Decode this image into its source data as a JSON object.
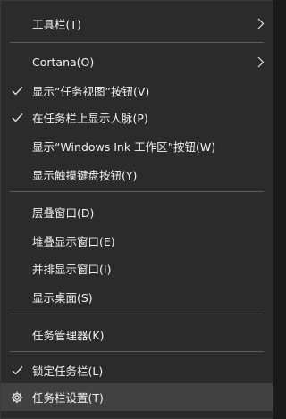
{
  "menu": {
    "items": [
      {
        "label": "工具栏(T)"
      },
      {
        "label": "Cortana(O)"
      },
      {
        "label": "显示“任务视图”按钮(V)"
      },
      {
        "label": "在任务栏上显示人脉(P)"
      },
      {
        "label": "显示“Windows Ink 工作区”按钮(W)"
      },
      {
        "label": "显示触摸键盘按钮(Y)"
      },
      {
        "label": "层叠窗口(D)"
      },
      {
        "label": "堆叠显示窗口(E)"
      },
      {
        "label": "并排显示窗口(I)"
      },
      {
        "label": "显示桌面(S)"
      },
      {
        "label": "任务管理器(K)"
      },
      {
        "label": "锁定任务栏(L)"
      },
      {
        "label": "任务栏设置(T)"
      }
    ]
  },
  "icons": {
    "check": "check-icon",
    "submenu": "chevron-right-icon",
    "settings": "gear-icon"
  },
  "colors": {
    "background": "#2b2b2b",
    "text": "#f2f2f2",
    "separator": "#5c5c5c",
    "hover": "#414141"
  }
}
